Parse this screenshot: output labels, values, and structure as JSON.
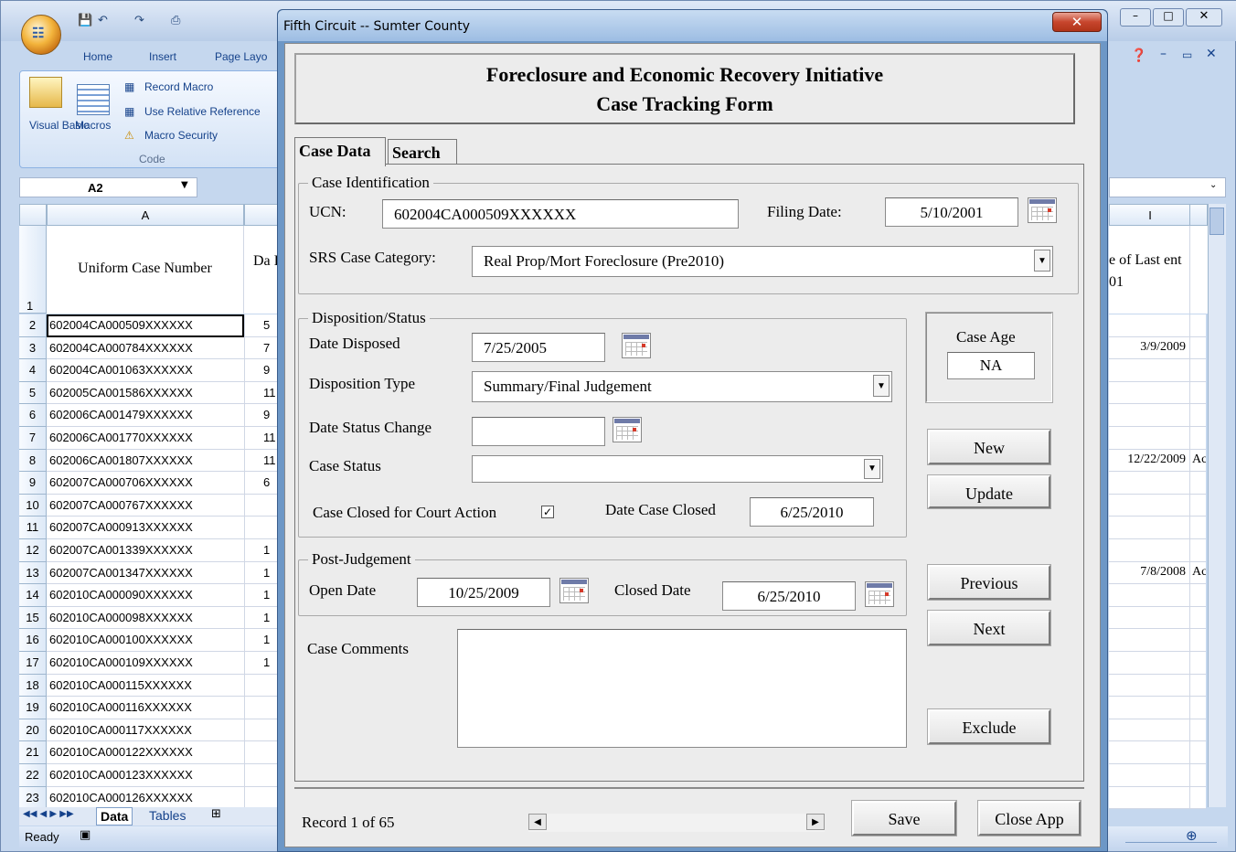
{
  "excel": {
    "qat_icons": [
      "save-icon",
      "undo-icon",
      "redo-icon",
      "print-icon"
    ],
    "ribbon_tabs": [
      "Home",
      "Insert",
      "Page Layo"
    ],
    "ribbon": {
      "visual_basic": "Visual Basic",
      "macros": "Macros",
      "record_macro": "Record Macro",
      "relative_ref": "Use Relative Reference",
      "macro_security": "Macro Security",
      "group_label": "Code"
    },
    "name_box": "A2",
    "col_a": "A",
    "col_i": "I",
    "header_a": "Uniform Case Number",
    "header_b": "Da I",
    "header_i": "e of Last ent 01",
    "rows": [
      {
        "n": "1",
        "a": "",
        "b": ""
      },
      {
        "n": "2",
        "a": "602004CA000509XXXXXX",
        "b": "5"
      },
      {
        "n": "3",
        "a": "602004CA000784XXXXXX",
        "b": "7"
      },
      {
        "n": "4",
        "a": "602004CA001063XXXXXX",
        "b": "9"
      },
      {
        "n": "5",
        "a": "602005CA001586XXXXXX",
        "b": "11"
      },
      {
        "n": "6",
        "a": "602006CA001479XXXXXX",
        "b": "9"
      },
      {
        "n": "7",
        "a": "602006CA001770XXXXXX",
        "b": "11"
      },
      {
        "n": "8",
        "a": "602006CA001807XXXXXX",
        "b": "11"
      },
      {
        "n": "9",
        "a": "602007CA000706XXXXXX",
        "b": "6"
      },
      {
        "n": "10",
        "a": "602007CA000767XXXXXX",
        "b": ""
      },
      {
        "n": "11",
        "a": "602007CA000913XXXXXX",
        "b": ""
      },
      {
        "n": "12",
        "a": "602007CA001339XXXXXX",
        "b": "1"
      },
      {
        "n": "13",
        "a": "602007CA001347XXXXXX",
        "b": "1"
      },
      {
        "n": "14",
        "a": "602010CA000090XXXXXX",
        "b": "1"
      },
      {
        "n": "15",
        "a": "602010CA000098XXXXXX",
        "b": "1"
      },
      {
        "n": "16",
        "a": "602010CA000100XXXXXX",
        "b": "1"
      },
      {
        "n": "17",
        "a": "602010CA000109XXXXXX",
        "b": "1"
      },
      {
        "n": "18",
        "a": "602010CA000115XXXXXX",
        "b": ""
      },
      {
        "n": "19",
        "a": "602010CA000116XXXXXX",
        "b": ""
      },
      {
        "n": "20",
        "a": "602010CA000117XXXXXX",
        "b": ""
      },
      {
        "n": "21",
        "a": "602010CA000122XXXXXX",
        "b": ""
      },
      {
        "n": "22",
        "a": "602010CA000123XXXXXX",
        "b": ""
      },
      {
        "n": "23",
        "a": "602010CA000126XXXXXX",
        "b": ""
      }
    ],
    "right_col": [
      {
        "row": "3",
        "date": "3/9/2009",
        "extra": ""
      },
      {
        "row": "8",
        "date": "12/22/2009",
        "extra": "Ac"
      },
      {
        "row": "13",
        "date": "7/8/2008",
        "extra": "Ac"
      }
    ],
    "sheet_tabs": [
      "Data",
      "Tables"
    ],
    "status": "Ready"
  },
  "dialog": {
    "title": "Fifth Circuit --  Sumter County",
    "header_line1": "Foreclosure and Economic Recovery Initiative",
    "header_line2": "Case Tracking Form",
    "tabs": [
      "Case Data",
      "Search"
    ],
    "case_id": {
      "legend": "Case Identification",
      "ucn_label": "UCN:",
      "ucn_value": "602004CA000509XXXXXX",
      "filing_label": "Filing Date:",
      "filing_value": "5/10/2001",
      "srs_label": "SRS Case Category:",
      "srs_value": "Real Prop/Mort Foreclosure (Pre2010)"
    },
    "disposition": {
      "legend": "Disposition/Status",
      "date_disposed_label": "Date Disposed",
      "date_disposed_value": "7/25/2005",
      "disp_type_label": "Disposition Type",
      "disp_type_value": "Summary/Final Judgement",
      "date_status_label": "Date Status Change",
      "date_status_value": "",
      "case_status_label": "Case Status",
      "case_status_value": "",
      "closed_court_label": "Case Closed for Court Action",
      "closed_court_checked": "✓",
      "date_closed_label": "Date Case Closed",
      "date_closed_value": "6/25/2010"
    },
    "case_age": {
      "label": "Case Age",
      "value": "NA"
    },
    "post_judgement": {
      "legend": "Post-Judgement",
      "open_label": "Open Date",
      "open_value": "10/25/2009",
      "closed_label": "Closed Date",
      "closed_value": "6/25/2010"
    },
    "comments_label": "Case Comments",
    "comments_value": "",
    "buttons": {
      "new": "New",
      "update": "Update",
      "previous": "Previous",
      "next": "Next",
      "exclude": "Exclude",
      "save": "Save",
      "close_app": "Close App"
    },
    "record_label": "Record 1 of 65"
  }
}
